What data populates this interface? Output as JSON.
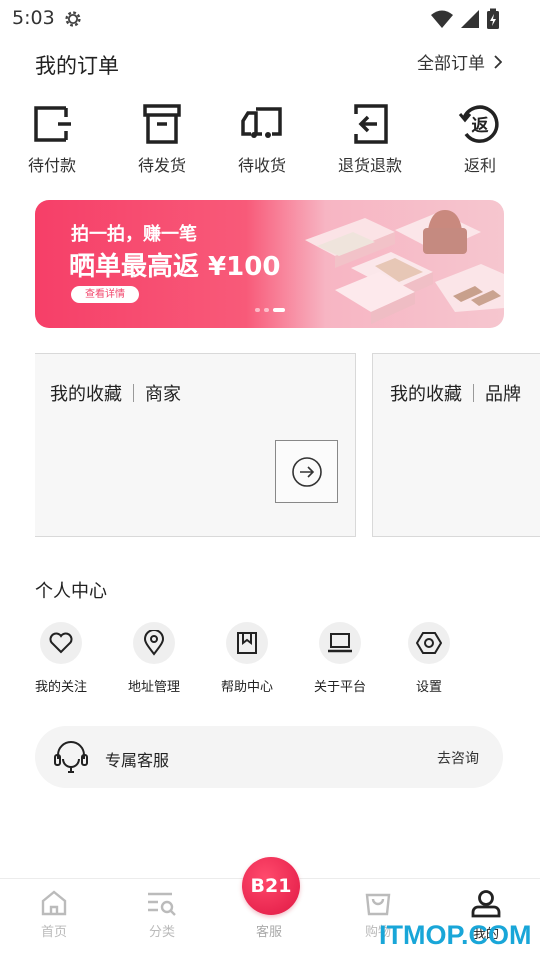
{
  "status_bar": {
    "time": "5:03"
  },
  "orders": {
    "title": "我的订单",
    "all_label": "全部订单",
    "items": [
      {
        "label": "待付款",
        "icon": "wallet-icon"
      },
      {
        "label": "待发货",
        "icon": "box-icon"
      },
      {
        "label": "待收货",
        "icon": "truck-icon"
      },
      {
        "label": "退货退款",
        "icon": "return-icon"
      },
      {
        "label": "返利",
        "icon": "rebate-icon"
      }
    ]
  },
  "banner": {
    "subtitle": "拍一拍，赚一笔",
    "headline": "晒单最高返 ¥100",
    "button": "查看详情"
  },
  "favorites": [
    {
      "title": "我的收藏",
      "tag": "商家"
    },
    {
      "title": "我的收藏",
      "tag": "品牌"
    }
  ],
  "personal": {
    "title": "个人中心",
    "items": [
      {
        "label": "我的关注",
        "icon": "heart-icon"
      },
      {
        "label": "地址管理",
        "icon": "location-pin-icon"
      },
      {
        "label": "帮助中心",
        "icon": "bookmark-icon"
      },
      {
        "label": "关于平台",
        "icon": "laptop-icon"
      },
      {
        "label": "设置",
        "icon": "hexagon-settings-icon"
      }
    ]
  },
  "service": {
    "label": "专属客服",
    "action": "去咨询"
  },
  "tabbar": {
    "items": [
      {
        "label": "首页",
        "icon": "home-icon"
      },
      {
        "label": "分类",
        "icon": "category-search-icon"
      },
      {
        "label": "客服",
        "icon": "b21-logo"
      },
      {
        "label": "购物",
        "icon": "shopping-bag-icon"
      },
      {
        "label": "我的",
        "icon": "person-icon"
      }
    ],
    "center_badge": "B21",
    "active": "我的"
  },
  "watermark": "ITMOP.COM",
  "colors": {
    "brand": "#f63f68",
    "watermark": "#19a6d8"
  }
}
